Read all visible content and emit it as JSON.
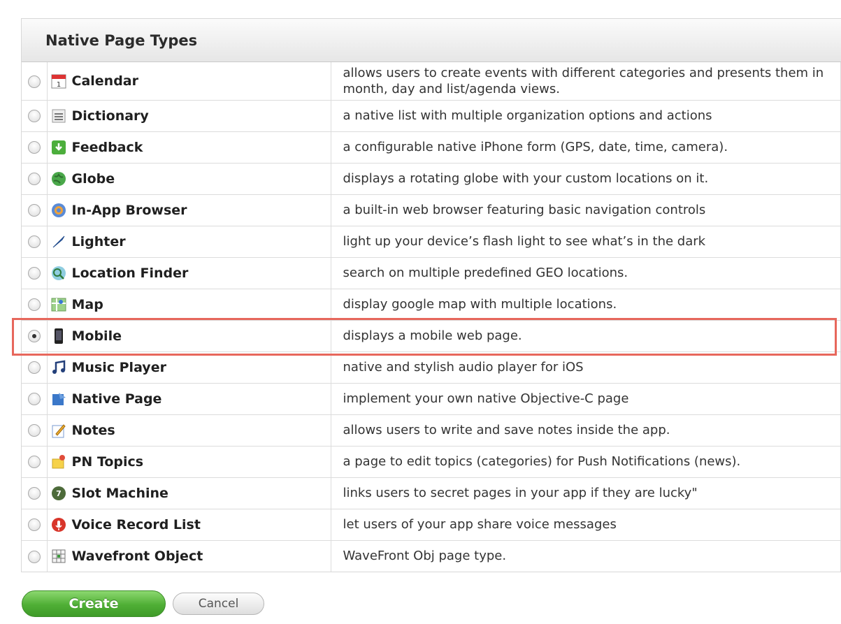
{
  "panel": {
    "title": "Native Page Types"
  },
  "rows": [
    {
      "name": "Calendar",
      "icon": "calendar-icon",
      "selected": false,
      "description": "allows users to create events with different categories and presents them in month, day and list/agenda views."
    },
    {
      "name": "Dictionary",
      "icon": "dictionary-icon",
      "selected": false,
      "description": "a native list with multiple organization options and actions"
    },
    {
      "name": "Feedback",
      "icon": "feedback-icon",
      "selected": false,
      "description": "a configurable native iPhone form (GPS, date, time, camera)."
    },
    {
      "name": "Globe",
      "icon": "globe-icon",
      "selected": false,
      "description": "displays a rotating globe with your custom locations on it."
    },
    {
      "name": "In-App Browser",
      "icon": "browser-icon",
      "selected": false,
      "description": "a built-in web browser featuring basic navigation controls"
    },
    {
      "name": "Lighter",
      "icon": "lighter-icon",
      "selected": false,
      "description": "light up your device’s flash light to see what’s in the dark"
    },
    {
      "name": "Location Finder",
      "icon": "location-finder-icon",
      "selected": false,
      "description": "search on multiple predefined GEO locations."
    },
    {
      "name": "Map",
      "icon": "map-icon",
      "selected": false,
      "description": "display google map with multiple locations."
    },
    {
      "name": "Mobile",
      "icon": "mobile-phone-icon",
      "selected": true,
      "description": "displays a mobile web page."
    },
    {
      "name": "Music Player",
      "icon": "music-note-icon",
      "selected": false,
      "description": "native and stylish audio player for iOS"
    },
    {
      "name": "Native Page",
      "icon": "native-page-icon",
      "selected": false,
      "description": "implement your own native Objective-C page"
    },
    {
      "name": "Notes",
      "icon": "notes-icon",
      "selected": false,
      "description": "allows users to write and save notes inside the app."
    },
    {
      "name": "PN Topics",
      "icon": "pn-topics-icon",
      "selected": false,
      "description": "a page to edit topics (categories) for Push Notifications (news)."
    },
    {
      "name": "Slot Machine",
      "icon": "slot-machine-icon",
      "selected": false,
      "description": "links users to secret pages in your app if they are lucky\""
    },
    {
      "name": "Voice Record List",
      "icon": "voice-record-icon",
      "selected": false,
      "description": "let users of your app share voice messages"
    },
    {
      "name": "Wavefront Object",
      "icon": "wavefront-object-icon",
      "selected": false,
      "description": "WaveFront Obj page type."
    }
  ],
  "actions": {
    "create_label": "Create",
    "cancel_label": "Cancel"
  },
  "colors": {
    "highlight": "#e7675c",
    "create_button": "#4fae35"
  }
}
